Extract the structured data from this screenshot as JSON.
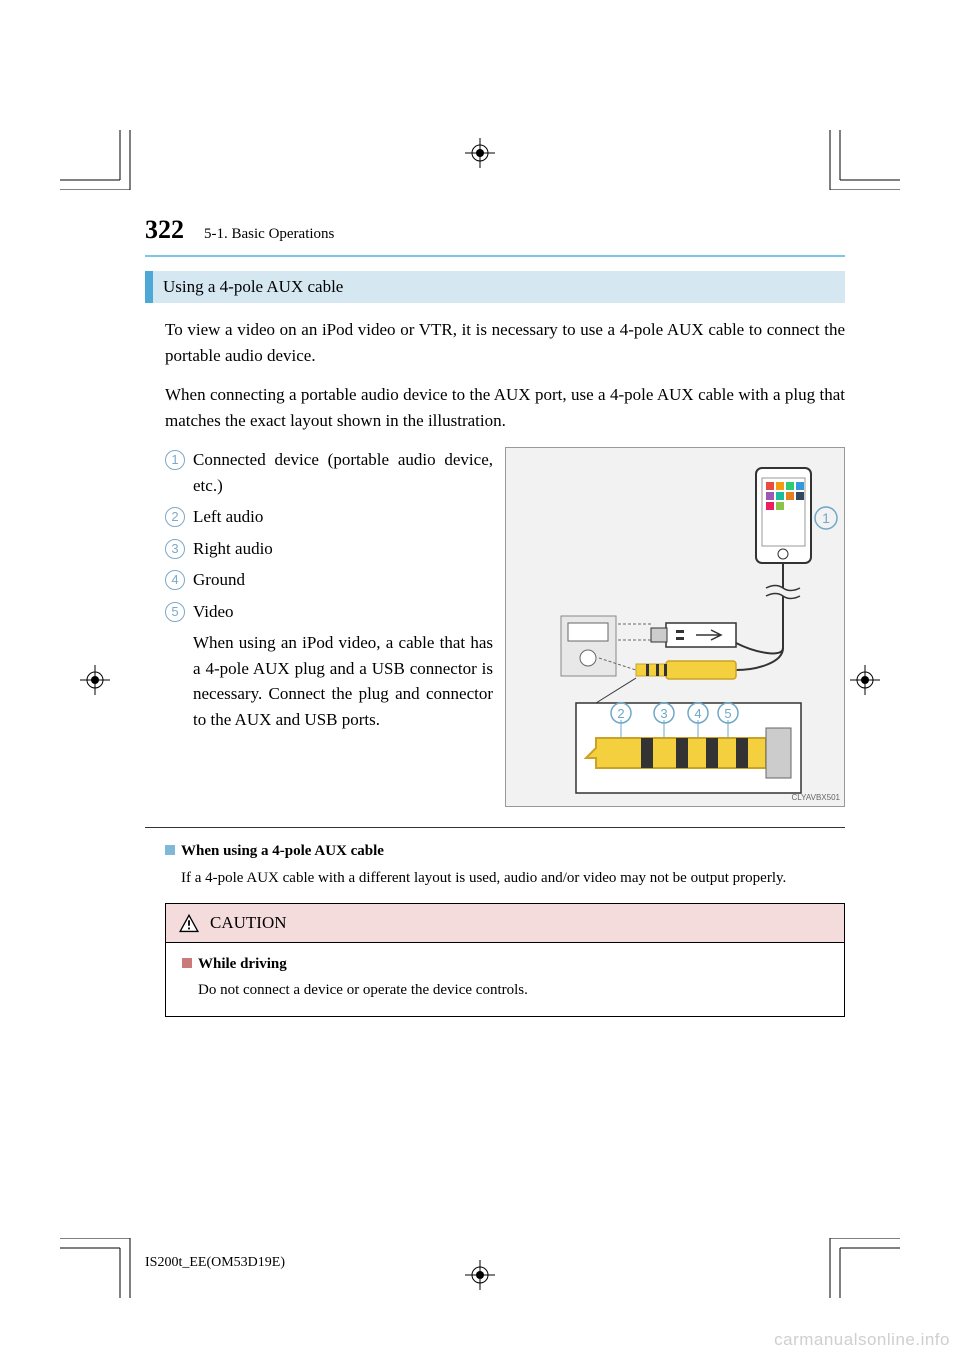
{
  "page": {
    "number": "322",
    "breadcrumb": "5-1. Basic Operations"
  },
  "section": {
    "title": "Using a 4-pole AUX cable",
    "para1": "To view a video on an iPod video or VTR, it is necessary to use a 4-pole AUX cable to connect the portable audio device.",
    "para2": "When connecting a portable audio device to the AUX port, use a 4-pole AUX cable with a plug that matches the exact layout shown in the illustration."
  },
  "list": {
    "items": [
      {
        "n": "1",
        "text": "Connected device (portable audio device, etc.)"
      },
      {
        "n": "2",
        "text": "Left audio"
      },
      {
        "n": "3",
        "text": "Right audio"
      },
      {
        "n": "4",
        "text": "Ground"
      },
      {
        "n": "5",
        "text": "Video"
      }
    ],
    "sub_para": "When using an iPod video, a cable that has a 4-pole AUX plug and a USB connector is necessary. Connect the plug and connector to the AUX and USB ports."
  },
  "illustration": {
    "code": "CLYAVBX501",
    "callouts": [
      "1",
      "2",
      "3",
      "4",
      "5"
    ]
  },
  "note": {
    "title": "When using a 4-pole AUX cable",
    "body": "If a 4-pole AUX cable with a different layout is used, audio and/or video may not be output properly."
  },
  "caution": {
    "label": "CAUTION",
    "title": "While driving",
    "body": "Do not connect a device or operate the device controls."
  },
  "footer": {
    "code": "IS200t_EE(OM53D19E)"
  },
  "watermark": "carmanualsonline.info"
}
